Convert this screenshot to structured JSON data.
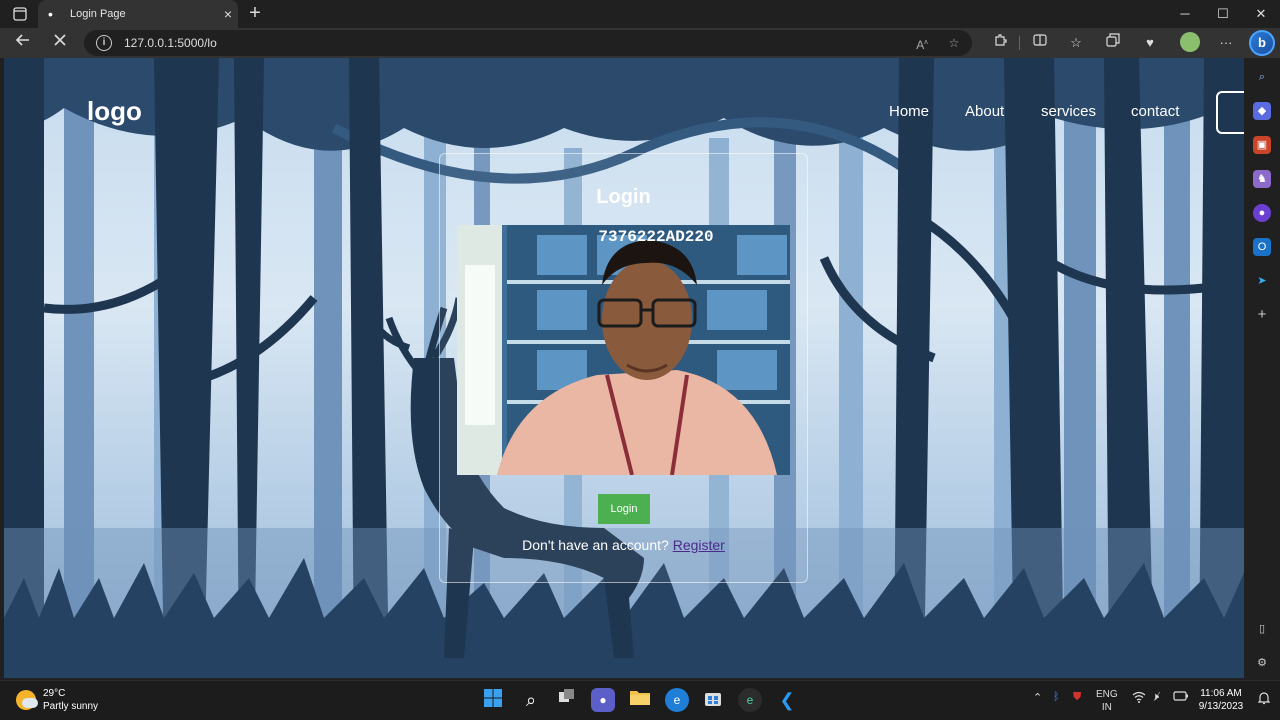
{
  "browser": {
    "tab_title": "Login Page",
    "tab_close": "×",
    "new_tab": "+",
    "url": "127.0.0.1:5000/lo",
    "window_controls": {
      "minimize": "─",
      "maximize": "☐",
      "close": "✕"
    }
  },
  "nav": {
    "logo": "logo",
    "links": [
      "Home",
      "About",
      "services",
      "contact"
    ]
  },
  "login": {
    "title": "Login",
    "camera_overlay_text": "7376222AD220",
    "button": "Login",
    "prompt": "Don't have an account?",
    "register_link": "Register"
  },
  "taskbar": {
    "weather_temp": "29°C",
    "weather_desc": "Partly sunny",
    "lang_line1": "ENG",
    "lang_line2": "IN",
    "time": "11:06 AM",
    "date": "9/13/2023"
  },
  "colors": {
    "login_button": "#4caf50",
    "register_link": "#4a2a8a",
    "forest_dark": "#1f3650",
    "sky": "#c7dcef"
  }
}
